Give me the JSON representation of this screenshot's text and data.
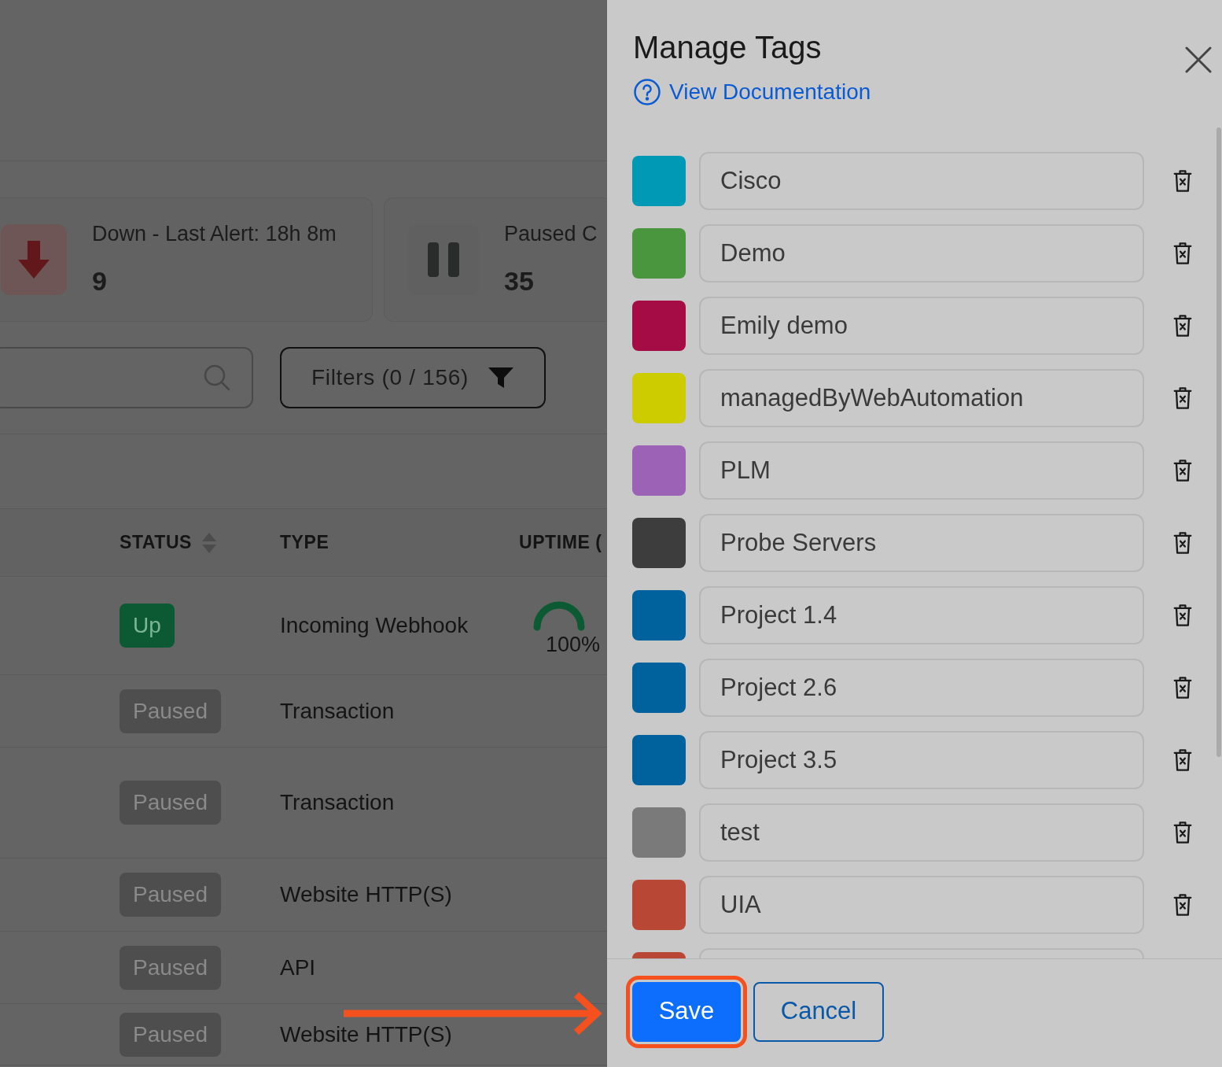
{
  "cards": [
    {
      "kind": "down",
      "label": "Down - Last Alert: 18h 8m",
      "count": "9"
    },
    {
      "kind": "paused",
      "label": "Paused C",
      "count": "35"
    }
  ],
  "filters": {
    "label": "Filters (0 / 156)"
  },
  "table": {
    "columns": [
      "STATUS",
      "TYPE",
      "UPTIME ("
    ],
    "rows": [
      {
        "status": "Up",
        "kind": "up",
        "type": "Incoming Webhook",
        "uptime": {
          "level": 1,
          "reading": "100%"
        }
      },
      {
        "status": "Paused",
        "kind": "paused",
        "type": "Transaction"
      },
      {
        "status": "Paused",
        "kind": "paused",
        "type": "Transaction"
      },
      {
        "status": "Paused",
        "kind": "paused",
        "type": "Website HTTP(S)"
      },
      {
        "status": "Paused",
        "kind": "paused",
        "type": "API"
      },
      {
        "status": "Paused",
        "kind": "paused",
        "type": "Website HTTP(S)"
      }
    ]
  },
  "dialog": {
    "title": "Manage Tags",
    "doc_link": "View Documentation",
    "tags": [
      {
        "name": "Cisco",
        "color": "#0099b5"
      },
      {
        "name": "Demo",
        "color": "#4a963e"
      },
      {
        "name": "Emily demo",
        "color": "#a50c45"
      },
      {
        "name": "managedByWebAutomation",
        "color": "#cccc00"
      },
      {
        "name": "PLM",
        "color": "#9b62b5"
      },
      {
        "name": "Probe Servers",
        "color": "#3d3d3d"
      },
      {
        "name": "Project 1.4",
        "color": "#00629c"
      },
      {
        "name": "Project 2.6",
        "color": "#00629c"
      },
      {
        "name": "Project 3.5",
        "color": "#00629c"
      },
      {
        "name": "test",
        "color": "#7a7a7a"
      },
      {
        "name": "UIA",
        "color": "#b94736"
      },
      {
        "color": "#b94736"
      }
    ],
    "buttons": [
      "Save",
      "Cancel"
    ]
  }
}
